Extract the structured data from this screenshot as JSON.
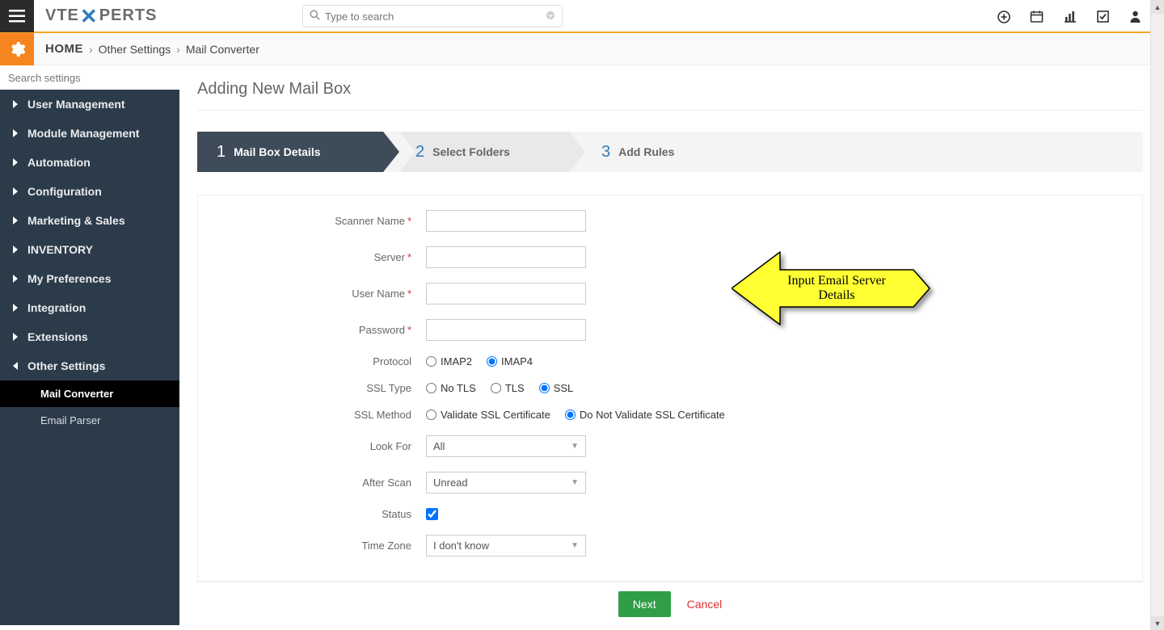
{
  "brand": {
    "pre": "VTE",
    "post": "PERTS"
  },
  "search": {
    "placeholder": "Type to search"
  },
  "breadcrumbs": {
    "home": "HOME",
    "level1": "Other Settings",
    "level2": "Mail Converter"
  },
  "sidebar": {
    "search_placeholder": "Search settings",
    "items": [
      {
        "label": "User Management"
      },
      {
        "label": "Module Management"
      },
      {
        "label": "Automation"
      },
      {
        "label": "Configuration"
      },
      {
        "label": "Marketing & Sales"
      },
      {
        "label": "INVENTORY"
      },
      {
        "label": "My Preferences"
      },
      {
        "label": "Integration"
      },
      {
        "label": "Extensions"
      },
      {
        "label": "Other Settings",
        "expanded": true,
        "children": [
          {
            "label": "Mail Converter",
            "active": true
          },
          {
            "label": "Email Parser"
          }
        ]
      }
    ]
  },
  "page": {
    "title": "Adding New Mail Box"
  },
  "wizard": {
    "steps": [
      {
        "num": "1",
        "label": "Mail Box Details"
      },
      {
        "num": "2",
        "label": "Select Folders"
      },
      {
        "num": "3",
        "label": "Add Rules"
      }
    ]
  },
  "form": {
    "scanner_name": {
      "label": "Scanner Name",
      "required": true,
      "value": ""
    },
    "server": {
      "label": "Server",
      "required": true,
      "value": ""
    },
    "user_name": {
      "label": "User Name",
      "required": true,
      "value": ""
    },
    "password": {
      "label": "Password",
      "required": true,
      "value": ""
    },
    "protocol": {
      "label": "Protocol",
      "options": [
        "IMAP2",
        "IMAP4"
      ],
      "selected": "IMAP4"
    },
    "ssl_type": {
      "label": "SSL Type",
      "options": [
        "No TLS",
        "TLS",
        "SSL"
      ],
      "selected": "SSL"
    },
    "ssl_method": {
      "label": "SSL Method",
      "options": [
        "Validate SSL Certificate",
        "Do Not Validate SSL Certificate"
      ],
      "selected": "Do Not Validate SSL Certificate"
    },
    "look_for": {
      "label": "Look For",
      "value": "All"
    },
    "after_scan": {
      "label": "After Scan",
      "value": "Unread"
    },
    "status": {
      "label": "Status",
      "checked": true
    },
    "time_zone": {
      "label": "Time Zone",
      "value": "I don't know"
    }
  },
  "callout": {
    "line1": "Input Email Server",
    "line2": "Details",
    "fill": "#ffff33",
    "stroke": "#000"
  },
  "footer": {
    "next": "Next",
    "cancel": "Cancel"
  }
}
